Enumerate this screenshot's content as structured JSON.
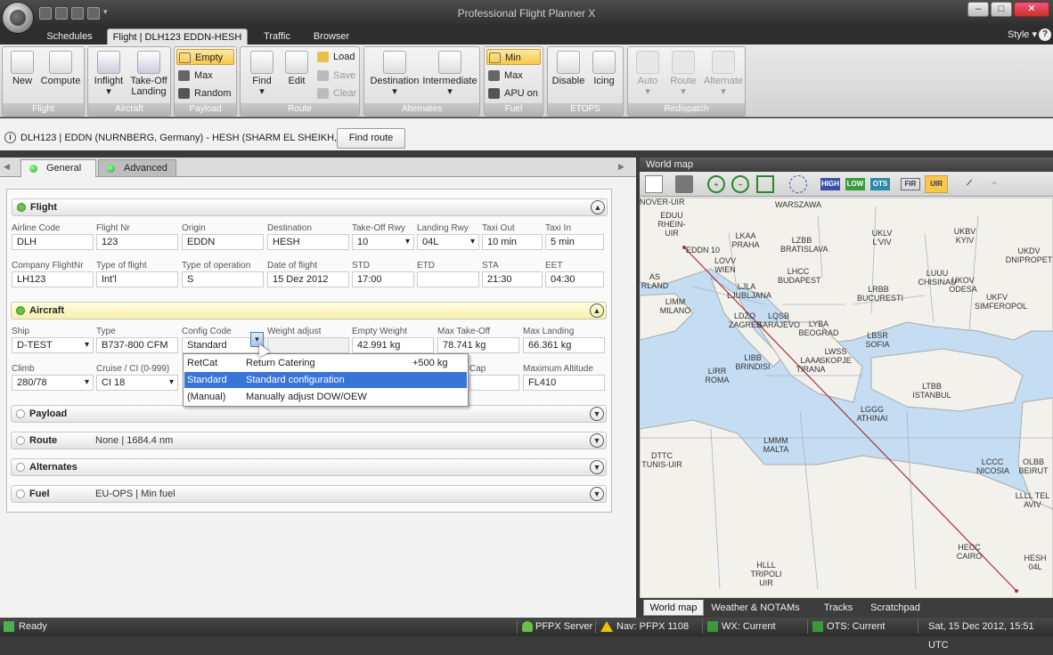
{
  "window": {
    "title": "Professional Flight Planner X",
    "min": "–",
    "max": "□",
    "close": "✕"
  },
  "ribbon_tabs": [
    "Schedules",
    "Flight | DLH123 EDDN-HESH",
    "Traffic",
    "Browser"
  ],
  "style_label": "Style",
  "help_label": "?",
  "ribbon": {
    "flight": {
      "label": "Flight",
      "new": "New",
      "compute": "Compute"
    },
    "aircraft": {
      "label": "Aircraft",
      "inflight": "Inflight",
      "takeoff": "Take-Off",
      "landing": "Landing"
    },
    "payload": {
      "label": "Payload",
      "empty": "Empty",
      "max": "Max",
      "random": "Random"
    },
    "route": {
      "label": "Route",
      "find": "Find",
      "edit": "Edit",
      "load": "Load",
      "save": "Save",
      "clear": "Clear"
    },
    "alternates": {
      "label": "Alternates",
      "destination": "Destination",
      "intermediate": "Intermediate"
    },
    "fuel": {
      "label": "Fuel",
      "min": "Min",
      "max": "Max",
      "apu": "APU on"
    },
    "etops": {
      "label": "ETOPS",
      "disable": "Disable",
      "icing": "Icing"
    },
    "redispatch": {
      "label": "Redispatch",
      "auto": "Auto",
      "route": "Route",
      "alternate": "Alternate"
    }
  },
  "route_bar": {
    "text": "DLH123 | EDDN (NURNBERG, Germany) - HESH (SHARM EL SHEIKH, Egypt)",
    "find_route": "Find route",
    "info": "i"
  },
  "panel_tabs": {
    "general": "General",
    "advanced": "Advanced"
  },
  "sections": {
    "flight": {
      "title": "Flight",
      "subtitle": "",
      "color": "#6cc04a"
    },
    "aircraft": {
      "title": "Aircraft",
      "subtitle": "",
      "color": "#6cc04a"
    },
    "payload": {
      "title": "Payload",
      "subtitle": "",
      "color": "#ffffff"
    },
    "route": {
      "title": "Route",
      "subtitle": "None | 1684.4 nm",
      "color": "#ffffff"
    },
    "alternates": {
      "title": "Alternates",
      "subtitle": "",
      "color": "#ffffff"
    },
    "fuel": {
      "title": "Fuel",
      "subtitle": "EU-OPS | Min fuel",
      "color": "#ffffff"
    }
  },
  "flight_fields": {
    "airline_code": {
      "label": "Airline Code",
      "value": "DLH"
    },
    "flight_nr": {
      "label": "Flight Nr",
      "value": "123"
    },
    "origin": {
      "label": "Origin",
      "value": "EDDN"
    },
    "destination": {
      "label": "Destination",
      "value": "HESH"
    },
    "takeoff_rwy": {
      "label": "Take-Off Rwy",
      "value": "10"
    },
    "landing_rwy": {
      "label": "Landing Rwy",
      "value": "04L"
    },
    "taxi_out": {
      "label": "Taxi Out",
      "value": "10 min"
    },
    "taxi_in": {
      "label": "Taxi In",
      "value": "5 min"
    },
    "company_flightnr": {
      "label": "Company FlightNr",
      "value": "LH123"
    },
    "type_of_flight": {
      "label": "Type of flight",
      "value": "Int'l"
    },
    "type_of_operation": {
      "label": "Type of operation",
      "value": "S"
    },
    "date_of_flight": {
      "label": "Date of flight",
      "value": "15 Dez 2012"
    },
    "std": {
      "label": "STD",
      "value": "17:00"
    },
    "etd": {
      "label": "ETD",
      "value": ""
    },
    "sta": {
      "label": "STA",
      "value": "21:30"
    },
    "eet": {
      "label": "EET",
      "value": "04:30"
    }
  },
  "aircraft_fields": {
    "ship": {
      "label": "Ship",
      "value": "D-TEST"
    },
    "type": {
      "label": "Type",
      "value": "B737-800 CFM"
    },
    "config_code": {
      "label": "Config Code",
      "value": "Standard"
    },
    "weight_adjust": {
      "label": "Weight adjust",
      "value": ""
    },
    "empty_weight": {
      "label": "Empty Weight",
      "value": "42.991 kg"
    },
    "max_takeoff": {
      "label": "Max Take-Off",
      "value": "78.741 kg"
    },
    "max_landing": {
      "label": "Max Landing",
      "value": "66.361 kg"
    },
    "climb": {
      "label": "Climb",
      "value": "280/78"
    },
    "cruise": {
      "label": "Cruise / CI (0-999)",
      "value": "CI 18"
    },
    "cap": {
      "label": "Cap",
      "value": ""
    },
    "max_altitude": {
      "label": "Maximum Altitude",
      "value": "FL410"
    }
  },
  "config_dropdown": [
    {
      "code": "RetCat",
      "desc": "Return Catering",
      "adj": "+500 kg",
      "selected": false
    },
    {
      "code": "Standard",
      "desc": "Standard configuration",
      "adj": "",
      "selected": true
    },
    {
      "code": "(Manual)",
      "desc": "Manually adjust DOW/OEW",
      "adj": "",
      "selected": false
    }
  ],
  "map": {
    "title": "World map",
    "tool_labels": {
      "high": "HIGH",
      "low": "LOW",
      "ots": "OTS",
      "fir": "FIR",
      "uir": "UIR"
    },
    "labels": [
      "NOVER-UIR",
      "EDUU RHEIN-UIR",
      "EDDN 10",
      "WARSZAWA",
      "LKAA PRAHA",
      "LZBB BRATISLAVA",
      "LOVV WIEN",
      "LHCC BUDAPEST",
      "LJLA LJUBLJANA",
      "UKLV L'VIV",
      "UKBV KYIV",
      "UKDV DNIPROPET",
      "LUUU CHISINAU",
      "UKOV ODESA",
      "UKFV SIMFEROPOL",
      "LRBB BUCURESTI",
      "AS RLAND",
      "LIMM MILANO",
      "LDZO ZAGREB",
      "LQSB SARAJEVO",
      "LYBA BEOGRAD",
      "LBSR SOFIA",
      "LIBB BRINDISI",
      "LAAA TIRANA",
      "LWSS SKOPJE",
      "LIRR ROMA",
      "LTBB ISTANBUL",
      "LGGG ATHINAI",
      "LMMM MALTA",
      "DTTC TUNIS-UIR",
      "LCCC NICOSIA",
      "OLBB BEIRUT",
      "LLLL TEL AVIV",
      "HECC CAIRO",
      "HLLL TRIPOLI UIR",
      "HESH 04L"
    ]
  },
  "map_tabs": [
    "World map",
    "Weather & NOTAMs",
    "Tracks",
    "Scratchpad"
  ],
  "status": {
    "ready": "Ready",
    "server": "PFPX Server",
    "nav": "Nav: PFPX 1108",
    "wx": "WX: Current",
    "ots": "OTS: Current",
    "datetime": "Sat, 15 Dec 2012, 15:51 UTC"
  }
}
